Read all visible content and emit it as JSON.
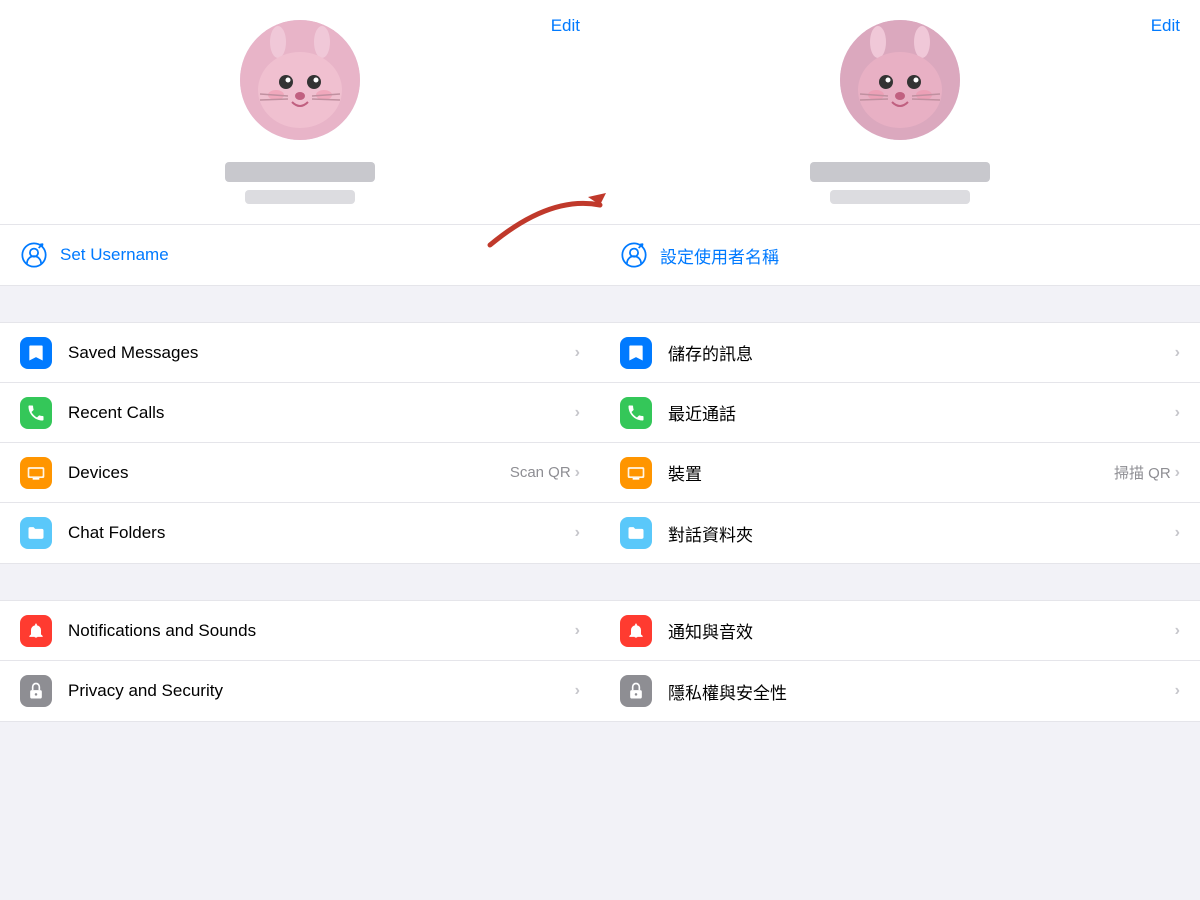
{
  "left": {
    "edit_label": "Edit",
    "set_username_label": "Set Username",
    "menu_items": [
      {
        "id": "saved-messages",
        "label": "Saved Messages",
        "icon_color": "blue",
        "icon_type": "bookmark",
        "secondary": "",
        "chevron": "›"
      },
      {
        "id": "recent-calls",
        "label": "Recent Calls",
        "icon_color": "green",
        "icon_type": "phone",
        "secondary": "",
        "chevron": "›"
      },
      {
        "id": "devices",
        "label": "Devices",
        "icon_color": "orange",
        "icon_type": "laptop",
        "secondary": "Scan QR",
        "chevron": "›"
      },
      {
        "id": "chat-folders",
        "label": "Chat Folders",
        "icon_color": "teal",
        "icon_type": "folder",
        "secondary": "",
        "chevron": "›"
      }
    ],
    "menu_items2": [
      {
        "id": "notifications",
        "label": "Notifications and Sounds",
        "icon_color": "red",
        "icon_type": "bell",
        "secondary": "",
        "chevron": "›"
      },
      {
        "id": "privacy",
        "label": "Privacy and Security",
        "icon_color": "gray",
        "icon_type": "lock",
        "secondary": "",
        "chevron": "›"
      }
    ]
  },
  "right": {
    "edit_label": "Edit",
    "set_username_label": "設定使用者名稱",
    "menu_items": [
      {
        "id": "saved-messages-zh",
        "label": "儲存的訊息",
        "icon_color": "blue",
        "icon_type": "bookmark",
        "secondary": "",
        "chevron": "›"
      },
      {
        "id": "recent-calls-zh",
        "label": "最近通話",
        "icon_color": "green",
        "icon_type": "phone",
        "secondary": "",
        "chevron": "›"
      },
      {
        "id": "devices-zh",
        "label": "裝置",
        "icon_color": "orange",
        "icon_type": "laptop",
        "secondary": "掃描 QR",
        "chevron": "›"
      },
      {
        "id": "chat-folders-zh",
        "label": "對話資料夾",
        "icon_color": "teal",
        "icon_type": "folder",
        "secondary": "",
        "chevron": "›"
      }
    ],
    "menu_items2": [
      {
        "id": "notifications-zh",
        "label": "通知與音效",
        "icon_color": "red",
        "icon_type": "bell",
        "secondary": "",
        "chevron": "›"
      },
      {
        "id": "privacy-zh",
        "label": "隱私權與安全性",
        "icon_color": "gray",
        "icon_type": "lock",
        "secondary": "",
        "chevron": "›"
      }
    ]
  },
  "arrow": {
    "color": "#c0392b"
  }
}
